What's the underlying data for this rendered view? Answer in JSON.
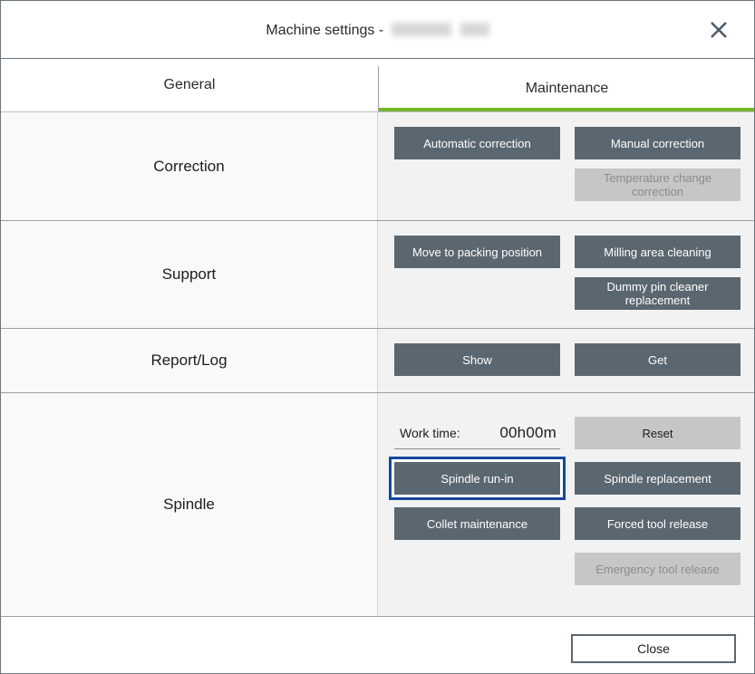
{
  "window": {
    "title_prefix": "Machine settings - ",
    "title_redacted": true,
    "close_icon": "close-icon"
  },
  "tabs": [
    {
      "label": "General",
      "active": false
    },
    {
      "label": "Maintenance",
      "active": true
    }
  ],
  "accent": {
    "tab_underline": "#76b72a",
    "button_fill": "#5b6770",
    "button_disabled_fill": "#c6c6c6",
    "focus_ring": "#17479e"
  },
  "sections": [
    {
      "label": "Correction",
      "buttons": [
        {
          "label": "Automatic correction",
          "state": "enabled",
          "column": "left"
        },
        {
          "label": "Manual correction",
          "state": "enabled",
          "column": "right"
        },
        {
          "label": "Temperature change correction",
          "state": "disabled",
          "column": "right"
        }
      ]
    },
    {
      "label": "Support",
      "buttons": [
        {
          "label": "Move to packing position",
          "state": "enabled",
          "column": "left"
        },
        {
          "label": "Milling area cleaning",
          "state": "enabled",
          "column": "right"
        },
        {
          "label": "Dummy pin cleaner\nreplacement",
          "state": "enabled",
          "column": "right"
        }
      ]
    },
    {
      "label": "Report/Log",
      "buttons": [
        {
          "label": "Show",
          "state": "enabled",
          "column": "left"
        },
        {
          "label": "Get",
          "state": "enabled",
          "column": "right"
        }
      ]
    },
    {
      "label": "Spindle",
      "work_time": {
        "label": "Work time:",
        "value": "00h00m"
      },
      "buttons": [
        {
          "label": "Reset",
          "state": "neutral",
          "column": "right"
        },
        {
          "label": "Spindle run-in",
          "state": "enabled",
          "column": "left",
          "focused": true
        },
        {
          "label": "Spindle replacement",
          "state": "enabled",
          "column": "right"
        },
        {
          "label": "Collet maintenance",
          "state": "enabled",
          "column": "left"
        },
        {
          "label": "Forced tool release",
          "state": "enabled",
          "column": "right"
        },
        {
          "label": "Emergency tool release",
          "state": "disabled",
          "column": "right"
        }
      ]
    }
  ],
  "footer": {
    "close_label": "Close"
  }
}
